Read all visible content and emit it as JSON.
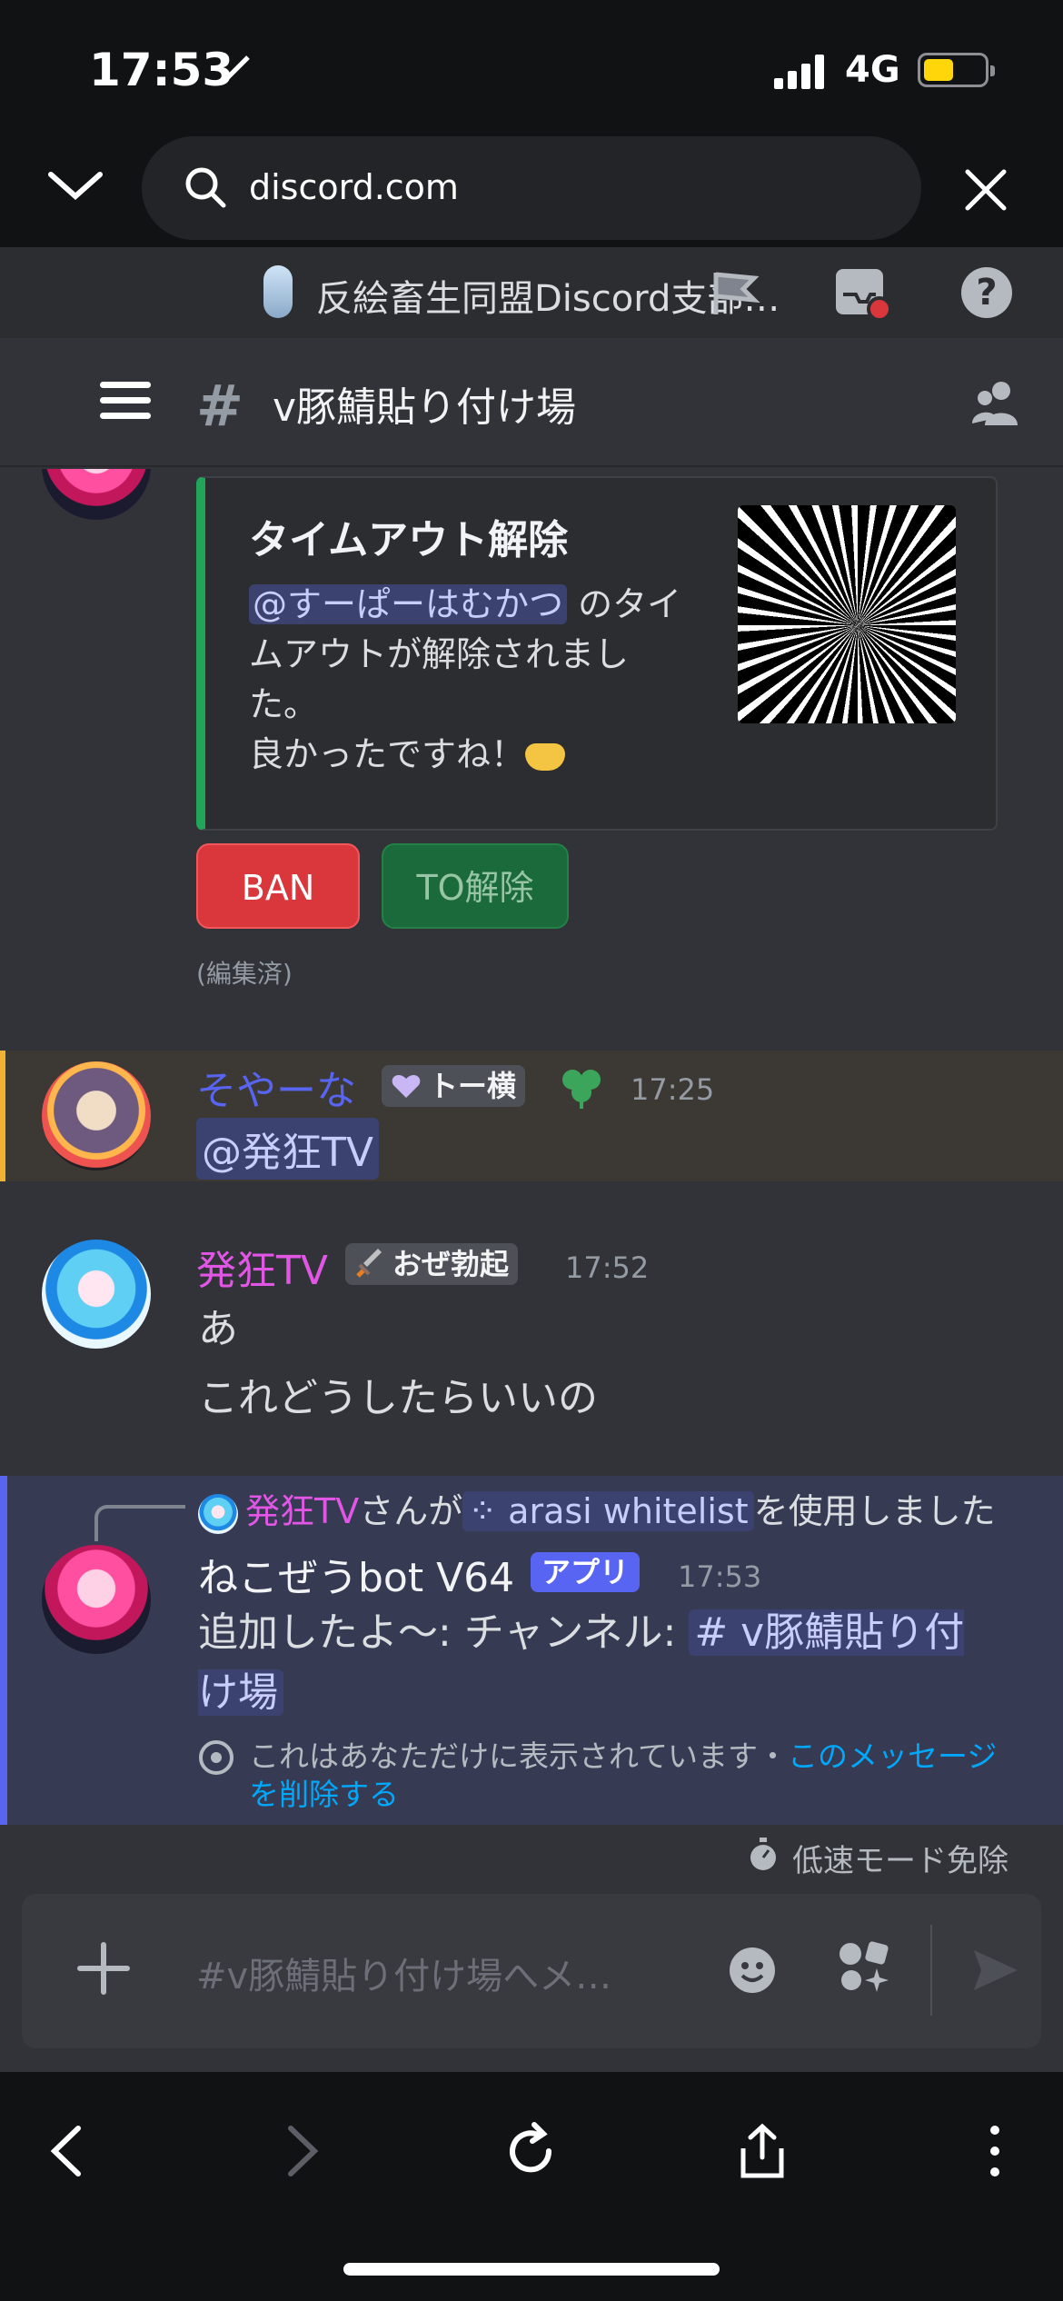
{
  "status": {
    "time": "17:53",
    "network": "4G"
  },
  "browser": {
    "url": "discord.com",
    "icons": [
      "chevron-down-icon",
      "search-icon",
      "close-icon"
    ]
  },
  "server": {
    "name": "反絵畜生同盟Discord支部…"
  },
  "channel": {
    "name": "v豚鯖貼り付け場",
    "hash": "#"
  },
  "embed": {
    "title": "タイムアウト解除",
    "mention": "@すーぱーはむかつ",
    "desc_rest": " のタイムアウトが解除されました。",
    "line2": "良かったですね！",
    "accent": "#23a559"
  },
  "buttons": {
    "ban": "BAN",
    "to_release": "TO解除"
  },
  "edited": "(編集済)",
  "msg1": {
    "user": "そやーな",
    "tag": "トー横",
    "time": "17:25",
    "mention": "@発狂TV"
  },
  "msg2": {
    "user": "発狂TV",
    "tag": "おぜ勃起",
    "time": "17:52",
    "line1": "あ",
    "line2": "これどうしたらいいの"
  },
  "msg3": {
    "reply_user": "発狂TV",
    "reply_mid": "さんが",
    "reply_cmd": "arasi whitelist",
    "reply_end": "を使用しました",
    "user": "ねこぜうbot V64",
    "badge": "アプリ",
    "time": "17:53",
    "text": "追加したよ〜: チャンネル: ",
    "channel_chip": "# v豚鯖貼り付け場",
    "ephemeral": "これはあなただけに表示されています・",
    "delete_link": "このメッセージを削除する"
  },
  "slowmode": "低速モード免除",
  "composer": {
    "placeholder": "#v豚鯖貼り付け場へメ…"
  }
}
